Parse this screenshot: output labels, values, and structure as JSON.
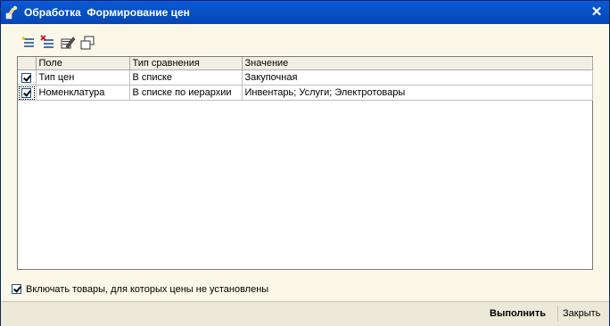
{
  "window": {
    "title": "Обработка  Формирование цен",
    "close_symbol": "✕"
  },
  "toolbar": {
    "buttons": [
      {
        "name": "add-row-icon"
      },
      {
        "name": "delete-row-icon"
      },
      {
        "name": "edit-icon"
      },
      {
        "name": "copy-icon"
      }
    ]
  },
  "grid": {
    "columns": [
      "Поле",
      "Тип сравнения",
      "Значение"
    ],
    "rows": [
      {
        "checked": true,
        "field": "Тип цен",
        "comparison": "В списке",
        "value": "Закупочная"
      },
      {
        "checked": true,
        "field": "Номенклатура",
        "comparison": "В списке по иерархии",
        "value": "Инвентарь; Услуги; Электротовары"
      }
    ]
  },
  "options": {
    "include_unpriced_label": "Включать товары, для которых цены не установлены",
    "include_unpriced_checked": true
  },
  "footer": {
    "run_label": "Выполнить",
    "close_label": "Закрыть"
  },
  "colors": {
    "titlebar": "#0852c8",
    "window_bg": "#fbf8e9",
    "footer_bg": "#ece9d8"
  }
}
